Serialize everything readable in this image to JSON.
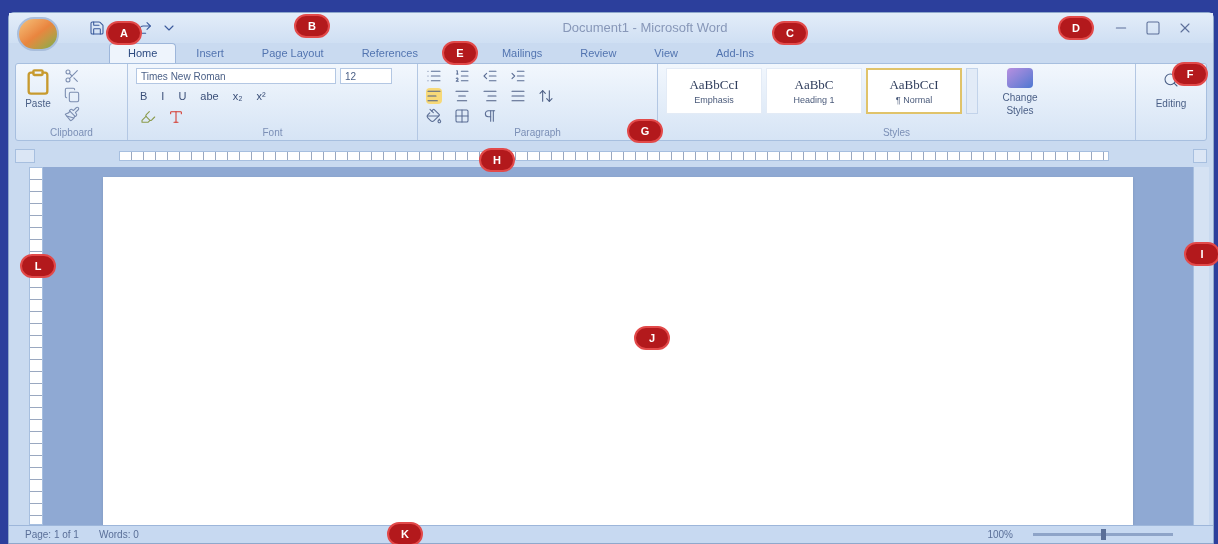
{
  "title_bar": {
    "title": "Document1 - Microsoft Word"
  },
  "tabs": [
    {
      "label": "Home",
      "selected": true
    },
    {
      "label": "Insert",
      "selected": false
    },
    {
      "label": "Page Layout",
      "selected": false
    },
    {
      "label": "References",
      "selected": false
    },
    {
      "label": "Mailings",
      "selected": false
    },
    {
      "label": "Review",
      "selected": false
    },
    {
      "label": "View",
      "selected": false
    },
    {
      "label": "Add-Ins",
      "selected": false
    }
  ],
  "ribbon": {
    "clipboard": {
      "paste": "Paste",
      "group_label": "Clipboard"
    },
    "font": {
      "font_name": "Times New Roman",
      "font_size": "12",
      "format_buttons": [
        "B",
        "I",
        "U",
        "abe",
        "x₂",
        "x²"
      ],
      "group_label": "Font"
    },
    "paragraph": {
      "group_label": "Paragraph"
    },
    "styles": {
      "group_label": "Styles",
      "items": [
        {
          "preview": "AaBbCcI",
          "name": "Emphasis",
          "selected": false
        },
        {
          "preview": "AaBbC",
          "name": "Heading 1",
          "selected": false
        },
        {
          "preview": "AaBbCcI",
          "name": "¶ Normal",
          "selected": true
        }
      ],
      "change_styles": "Change Styles"
    },
    "editing": "Editing"
  },
  "status_bar": {
    "page": "Page: 1 of 1",
    "words": "Words: 0",
    "zoom": "100%",
    "zoom_slider": {
      "level": 0.5
    }
  },
  "callouts": [
    {
      "letter": "A"
    },
    {
      "letter": "B"
    },
    {
      "letter": "C"
    },
    {
      "letter": "D"
    },
    {
      "letter": "E"
    },
    {
      "letter": "F"
    },
    {
      "letter": "G"
    },
    {
      "letter": "H"
    },
    {
      "letter": "I"
    },
    {
      "letter": "J"
    },
    {
      "letter": "K"
    },
    {
      "letter": "L"
    }
  ]
}
